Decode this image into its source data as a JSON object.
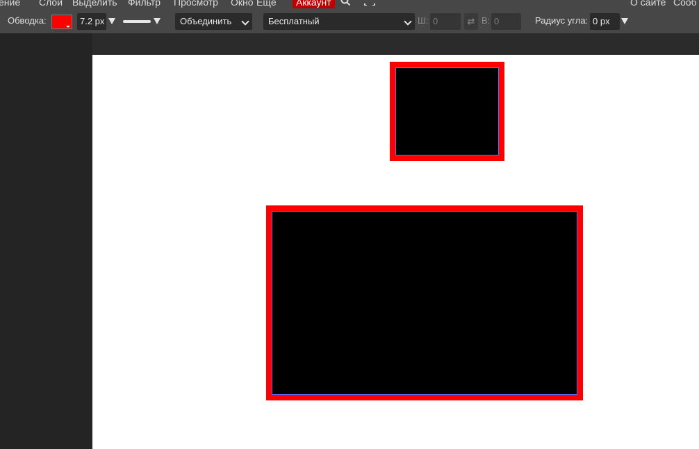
{
  "menu": {
    "items": [
      "ение",
      "Слой",
      "Выделить",
      "Фильтр",
      "Просмотр",
      "Окно",
      "Ещё"
    ],
    "account": "Аккаунт",
    "right": [
      "О сайте",
      "Сооб"
    ]
  },
  "toolbar": {
    "stroke_label": "Обводка:",
    "stroke_color": "#ff0000",
    "stroke_width": "7.2 px",
    "combine_value": "Объединить",
    "font_value": "Бесплатный",
    "w_label": "Ш:",
    "w_value": "0",
    "h_label": "В:",
    "h_value": "0",
    "swap_glyph": "⇄",
    "corner_radius_label": "Радиус угла:",
    "corner_radius_value": "0 px"
  },
  "colors": {
    "stroke": "#ff0000",
    "fill": "#000000",
    "selection": "#5a6bff",
    "account_bg": "#c00000"
  },
  "canvas": {
    "shapes": [
      {
        "name": "small-rectangle",
        "fill": "#000000",
        "stroke": "#ff0000"
      },
      {
        "name": "large-rectangle",
        "fill": "#000000",
        "stroke": "#ff0000"
      }
    ]
  }
}
